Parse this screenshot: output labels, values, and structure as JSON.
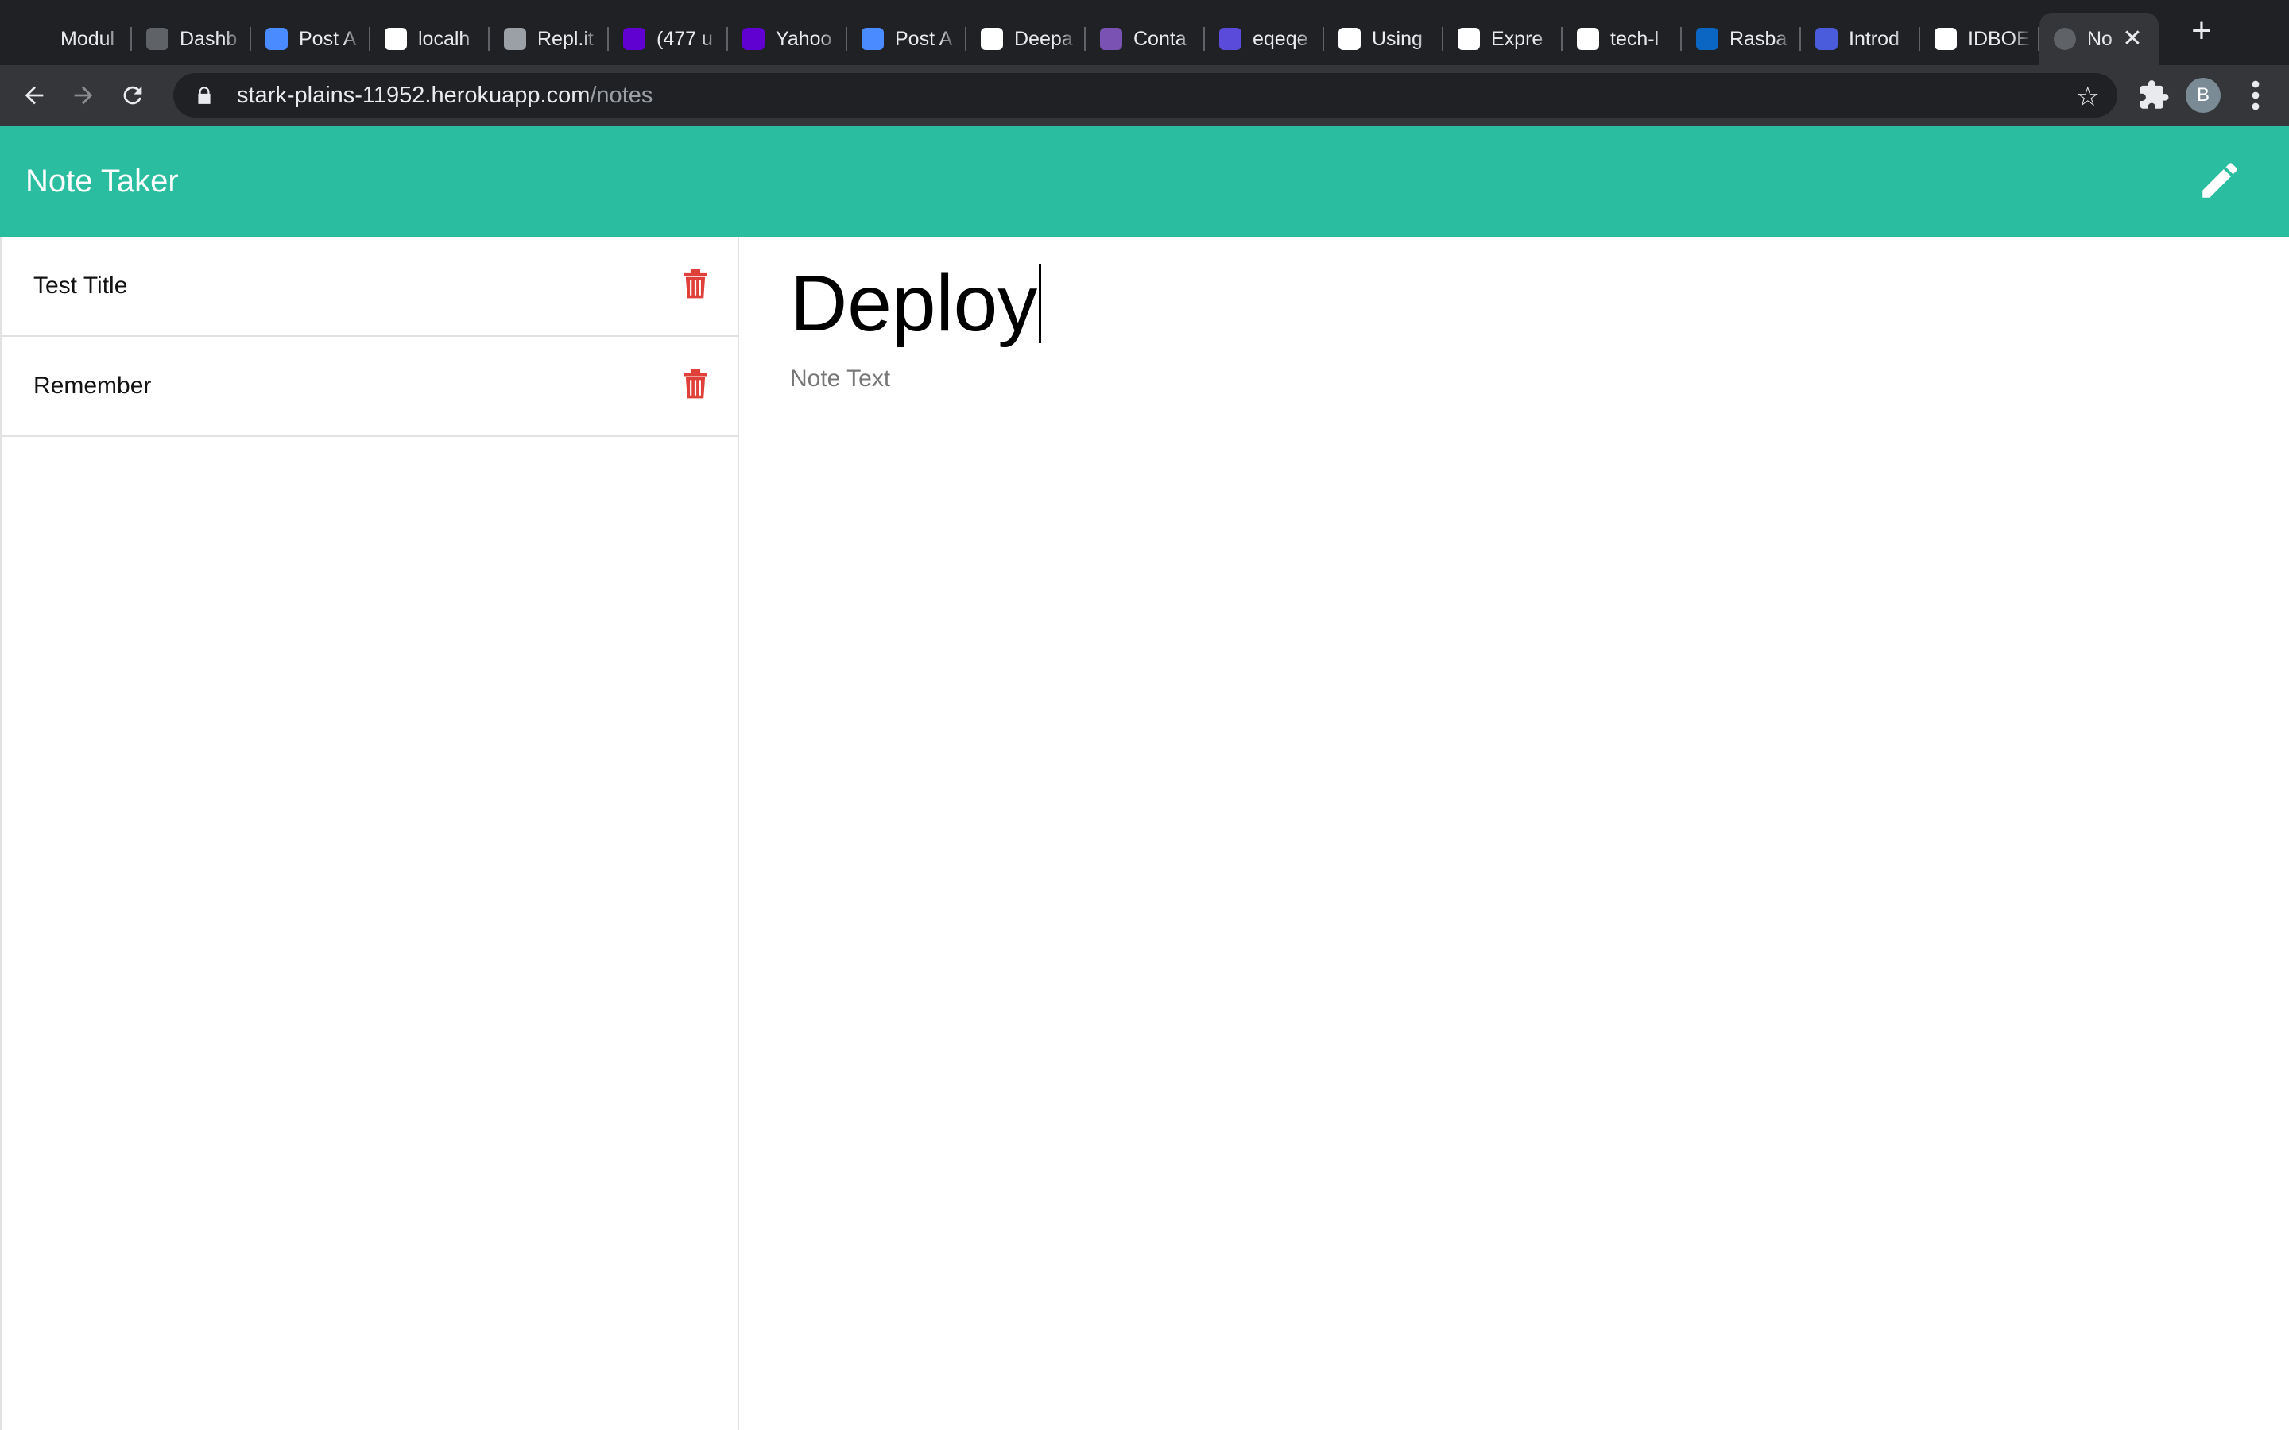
{
  "browser": {
    "tabs": [
      {
        "title": "Modul",
        "icon": "book-icon",
        "color": "#202124"
      },
      {
        "title": "Dashb",
        "icon": "globe-icon",
        "color": "#5f6368"
      },
      {
        "title": "Post A",
        "icon": "zoom-icon",
        "color": "#4a8cff"
      },
      {
        "title": "localh",
        "icon": "google-icon",
        "color": "#ffffff"
      },
      {
        "title": "Repl.it",
        "icon": "replit-icon",
        "color": "#9aa0a6"
      },
      {
        "title": "(477 u",
        "icon": "yahoo-mail-icon",
        "color": "#6001d2"
      },
      {
        "title": "Yahoo",
        "icon": "yahoo-icon",
        "color": "#6001d2"
      },
      {
        "title": "Post A",
        "icon": "zoom-icon",
        "color": "#4a8cff"
      },
      {
        "title": "Deepa",
        "icon": "github-icon",
        "color": "#ffffff"
      },
      {
        "title": "Conta",
        "icon": "bootstrap-icon",
        "color": "#7952b3"
      },
      {
        "title": "eqeqe",
        "icon": "circle-icon",
        "color": "#5b4bdb"
      },
      {
        "title": "Using",
        "icon": "express-icon",
        "color": "#ffffff"
      },
      {
        "title": "Expre",
        "icon": "express-icon",
        "color": "#ffffff"
      },
      {
        "title": "tech-l",
        "icon": "github-icon",
        "color": "#ffffff"
      },
      {
        "title": "Rasba",
        "icon": "linkedin-icon",
        "color": "#0a66c2"
      },
      {
        "title": "Introd",
        "icon": "star-badge-icon",
        "color": "#4a5bdc"
      },
      {
        "title": "IDBOE",
        "icon": "shield-icon",
        "color": "#ffffff"
      }
    ],
    "active_tab": {
      "title": "No",
      "icon": "globe-icon",
      "close": "✕"
    },
    "new_tab": "+",
    "url_host": "stark-plains-11952.herokuapp.com",
    "url_path": "/notes",
    "profile_initial": "B"
  },
  "app": {
    "brand": "Note Taker",
    "notes": [
      {
        "title": "Test Title"
      },
      {
        "title": "Remember"
      }
    ],
    "editor": {
      "title_value": "Deploy",
      "text_placeholder": "Note Text"
    },
    "colors": {
      "header": "#2bbd9f",
      "delete": "#e0403a"
    }
  }
}
